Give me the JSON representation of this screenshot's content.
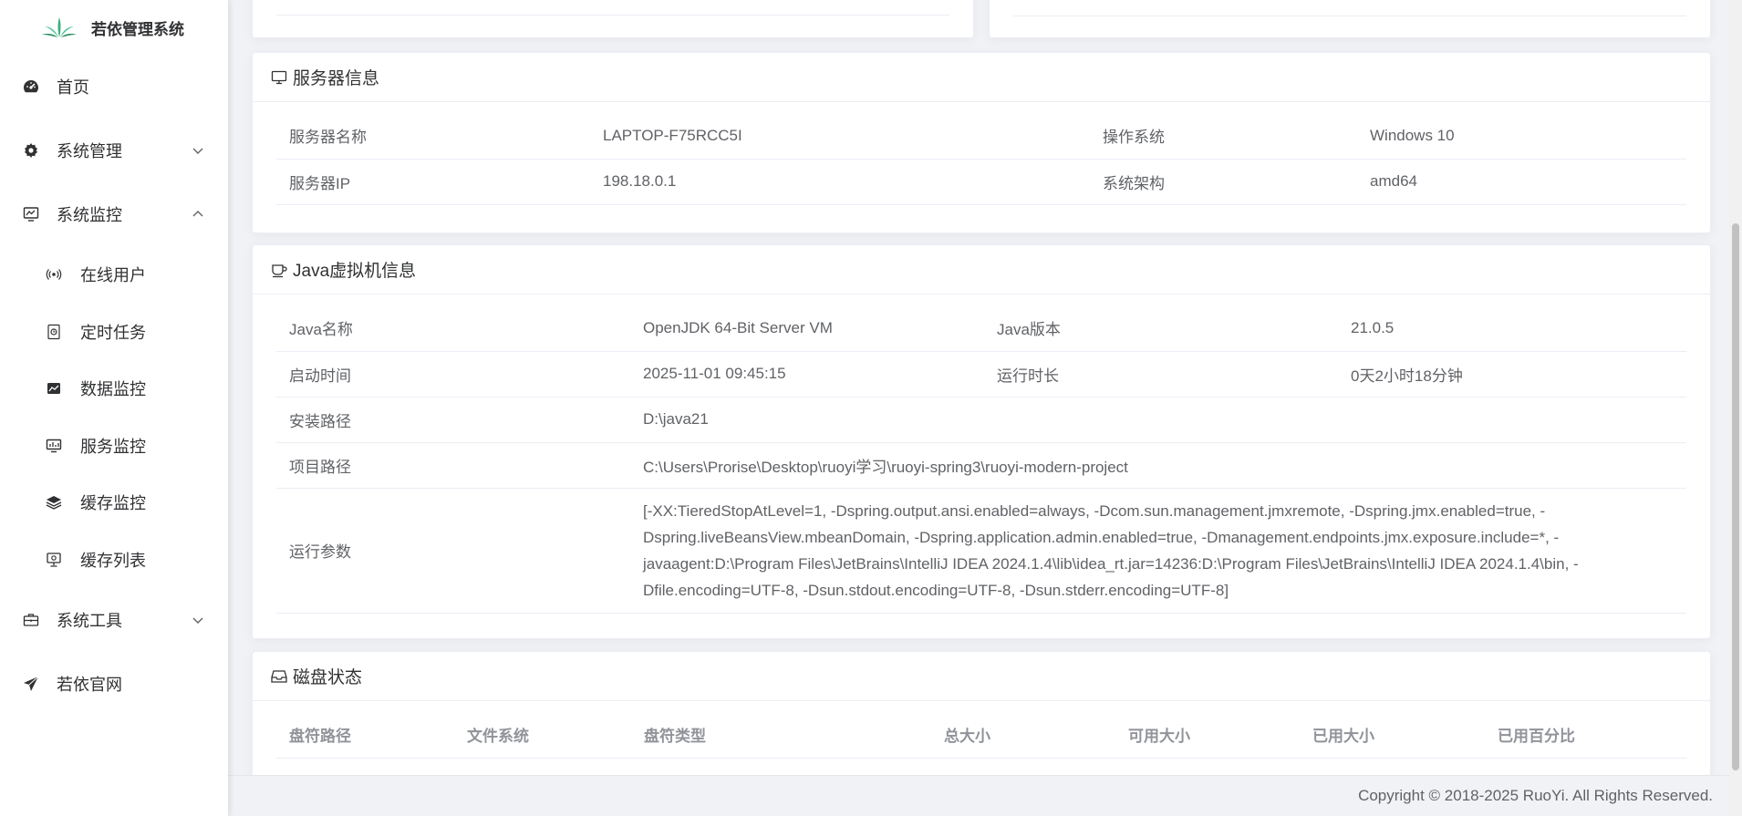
{
  "app": {
    "title": "若依管理系统"
  },
  "sidebar": {
    "items": [
      {
        "label": "首页",
        "icon": "dashboard-icon"
      },
      {
        "label": "系统管理",
        "icon": "gear-icon"
      },
      {
        "label": "系统监控",
        "icon": "monitor-icon",
        "expanded": true
      },
      {
        "label": "系统工具",
        "icon": "toolbox-icon"
      },
      {
        "label": "若依官网",
        "icon": "send-icon"
      }
    ],
    "monitor_sub": [
      {
        "label": "在线用户",
        "icon": "online-icon"
      },
      {
        "label": "定时任务",
        "icon": "job-icon"
      },
      {
        "label": "数据监控",
        "icon": "druid-icon"
      },
      {
        "label": "服务监控",
        "icon": "server-icon"
      },
      {
        "label": "缓存监控",
        "icon": "redis-icon"
      },
      {
        "label": "缓存列表",
        "icon": "redis-list-icon"
      }
    ]
  },
  "server_card": {
    "title": "服务器信息",
    "rows": [
      {
        "k1": "服务器名称",
        "v1": "LAPTOP-F75RCC5I",
        "k2": "操作系统",
        "v2": "Windows 10"
      },
      {
        "k1": "服务器IP",
        "v1": "198.18.0.1",
        "k2": "系统架构",
        "v2": "amd64"
      }
    ]
  },
  "jvm_card": {
    "title": "Java虚拟机信息",
    "rows": [
      {
        "k1": "Java名称",
        "v1": "OpenJDK 64-Bit Server VM",
        "k2": "Java版本",
        "v2": "21.0.5"
      },
      {
        "k1": "启动时间",
        "v1": "2025-11-01 09:45:15",
        "k2": "运行时长",
        "v2": "0天2小时18分钟"
      }
    ],
    "install_path": {
      "k": "安装路径",
      "v": "D:\\java21"
    },
    "project_path": {
      "k": "项目路径",
      "v": "C:\\Users\\Prorise\\Desktop\\ruoyi学习\\ruoyi-spring3\\ruoyi-modern-project"
    },
    "run_args": {
      "k": "运行参数",
      "v": "[-XX:TieredStopAtLevel=1, -Dspring.output.ansi.enabled=always, -Dcom.sun.management.jmxremote, -Dspring.jmx.enabled=true, -Dspring.liveBeansView.mbeanDomain, -Dspring.application.admin.enabled=true, -Dmanagement.endpoints.jmx.exposure.include=*, -javaagent:D:\\Program Files\\JetBrains\\IntelliJ IDEA 2024.1.4\\lib\\idea_rt.jar=14236:D:\\Program Files\\JetBrains\\IntelliJ IDEA 2024.1.4\\bin, -Dfile.encoding=UTF-8, -Dsun.stdout.encoding=UTF-8, -Dsun.stderr.encoding=UTF-8]"
    }
  },
  "disk_card": {
    "title": "磁盘状态",
    "headers": [
      "盘符路径",
      "文件系统",
      "盘符类型",
      "总大小",
      "可用大小",
      "已用大小",
      "已用百分比"
    ]
  },
  "footer": {
    "copyright": "Copyright © 2018-2025 RuoYi. All Rights Reserved."
  },
  "colors": {
    "logo_green": "#3eaf7c",
    "text": "#606266",
    "title": "#303133",
    "border": "#ebeef5"
  }
}
